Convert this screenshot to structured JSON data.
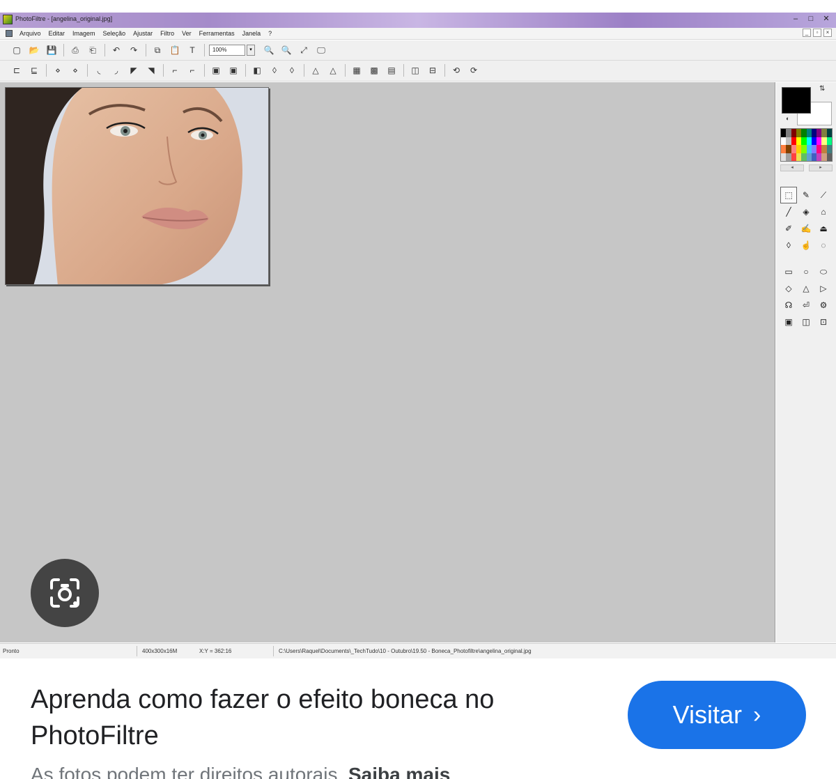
{
  "window": {
    "title": "PhotoFiltre - [angelina_original.jpg]",
    "controls": [
      "–",
      "□",
      "✕"
    ]
  },
  "menu": {
    "items": [
      "Arquivo",
      "Editar",
      "Imagem",
      "Seleção",
      "Ajustar",
      "Filtro",
      "Ver",
      "Ferramentas",
      "Janela",
      "?"
    ],
    "mdi_controls": [
      "_",
      "▫",
      "×"
    ]
  },
  "toolbar1": {
    "zoom_value": "100%",
    "zoom_drop": "▾"
  },
  "icons": {
    "new": "▢",
    "open": "📂",
    "save": "💾",
    "print": "⎙",
    "scanner": "⎗",
    "undo": "↶",
    "redo": "↷",
    "copy": "⧉",
    "paste": "📋",
    "text": "T",
    "zoom_in": "🔍",
    "zoom_out": "🔍",
    "fit": "⤢",
    "fullscreen": "🖵"
  },
  "statusbar": {
    "status": "Pronto",
    "dimensions": "400x300x16M",
    "coords": "X:Y = 362:16",
    "path": "C:\\Users\\Raquel\\Documents\\_TechTudo\\10 - Outubro\\19.50 - Boneca_Photofiltre\\angelina_original.jpg"
  },
  "palette_colors": [
    "#000000",
    "#808080",
    "#800000",
    "#808000",
    "#008000",
    "#008080",
    "#000080",
    "#800080",
    "#808040",
    "#004040",
    "#ffffff",
    "#c0c0c0",
    "#ff0000",
    "#ffff00",
    "#00ff00",
    "#00ffff",
    "#0000ff",
    "#ff00ff",
    "#ffff80",
    "#00ff80",
    "#ff8040",
    "#804000",
    "#ff8080",
    "#ffcc00",
    "#80ff00",
    "#40c0ff",
    "#8080ff",
    "#ff0080",
    "#c08040",
    "#408080",
    "#e0e0e0",
    "#a0a0a0",
    "#ff4040",
    "#f0e050",
    "#60c060",
    "#60a0d0",
    "#4060c0",
    "#c040c0",
    "#d0a080",
    "#606060"
  ],
  "caption": {
    "title": "Aprenda como fazer o efeito boneca no PhotoFiltre",
    "visit_label": "Visitar",
    "visit_chevron": "›",
    "disclaimer": "As fotos podem ter direitos autorais.",
    "learn_more": "Saiba mais"
  }
}
